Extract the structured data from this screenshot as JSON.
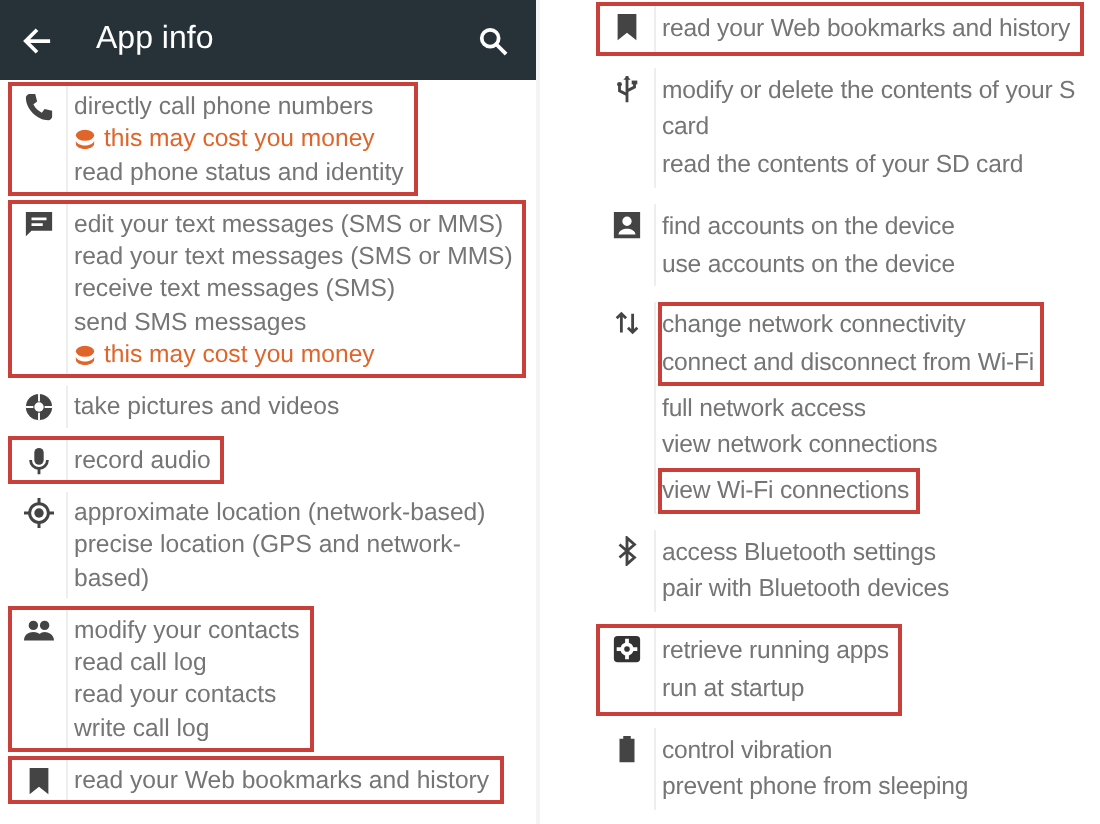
{
  "left_screen": {
    "app_bar": {
      "title": "App info"
    },
    "groups": [
      {
        "highlighted": true,
        "blocks": [
          {
            "highlighted": false,
            "lines": [
              {
                "kind": "permission",
                "text": "directly call phone numbers"
              },
              {
                "kind": "cost",
                "text": "this may cost you money"
              },
              {
                "kind": "permission",
                "text": "read phone status and identity"
              }
            ]
          }
        ]
      },
      {
        "highlighted": true,
        "blocks": [
          {
            "highlighted": false,
            "lines": [
              {
                "kind": "permission",
                "text": "edit your text messages (SMS or MMS)"
              },
              {
                "kind": "permission",
                "text": "read your text messages (SMS or MMS)"
              },
              {
                "kind": "permission",
                "text": "receive text messages (SMS)"
              },
              {
                "kind": "permission",
                "text": "send SMS messages"
              },
              {
                "kind": "cost",
                "text": "this may cost you money"
              }
            ]
          }
        ]
      },
      {
        "highlighted": false,
        "blocks": [
          {
            "highlighted": false,
            "lines": [
              {
                "kind": "permission",
                "text": "take pictures and videos"
              }
            ]
          }
        ]
      },
      {
        "highlighted": true,
        "blocks": [
          {
            "highlighted": false,
            "lines": [
              {
                "kind": "permission",
                "text": "record audio"
              }
            ]
          }
        ]
      },
      {
        "highlighted": false,
        "blocks": [
          {
            "highlighted": false,
            "lines": [
              {
                "kind": "permission",
                "text": "approximate location (network-based)"
              },
              {
                "kind": "permission",
                "text": "precise location (GPS and network-"
              },
              {
                "kind": "permission",
                "text": "based)"
              }
            ]
          }
        ]
      },
      {
        "highlighted": true,
        "blocks": [
          {
            "highlighted": false,
            "lines": [
              {
                "kind": "permission",
                "text": "modify your contacts"
              },
              {
                "kind": "permission",
                "text": "read call log"
              },
              {
                "kind": "permission",
                "text": "read your contacts"
              },
              {
                "kind": "permission",
                "text": "write call log"
              }
            ]
          }
        ]
      },
      {
        "highlighted": true,
        "blocks": [
          {
            "highlighted": false,
            "lines": [
              {
                "kind": "permission",
                "text": "read your Web bookmarks and history"
              }
            ]
          }
        ]
      }
    ]
  },
  "right_screen": {
    "groups": [
      {
        "highlighted": true,
        "blocks": [
          {
            "highlighted": false,
            "lines": [
              {
                "kind": "permission",
                "text": "read your Web bookmarks and history"
              }
            ]
          }
        ]
      },
      {
        "highlighted": false,
        "blocks": [
          {
            "highlighted": false,
            "lines": [
              {
                "kind": "permission",
                "text": "modify or delete the contents of your S"
              },
              {
                "kind": "permission",
                "text": "card"
              },
              {
                "kind": "permission",
                "text": "read the contents of your SD card"
              }
            ]
          }
        ]
      },
      {
        "highlighted": false,
        "blocks": [
          {
            "highlighted": false,
            "lines": [
              {
                "kind": "permission",
                "text": "find accounts on the device"
              },
              {
                "kind": "permission",
                "text": "use accounts on the device"
              }
            ]
          }
        ]
      },
      {
        "highlighted": false,
        "blocks": [
          {
            "highlighted": true,
            "lines": [
              {
                "kind": "permission",
                "text": "change network connectivity"
              },
              {
                "kind": "permission",
                "text": "connect and disconnect from Wi-Fi"
              }
            ]
          },
          {
            "highlighted": false,
            "lines": [
              {
                "kind": "permission",
                "text": "full network access"
              },
              {
                "kind": "permission",
                "text": "view network connections"
              }
            ]
          },
          {
            "highlighted": true,
            "lines": [
              {
                "kind": "permission",
                "text": "view Wi-Fi connections"
              }
            ]
          }
        ]
      },
      {
        "highlighted": false,
        "blocks": [
          {
            "highlighted": false,
            "lines": [
              {
                "kind": "permission",
                "text": "access Bluetooth settings"
              },
              {
                "kind": "permission",
                "text": "pair with Bluetooth devices"
              }
            ]
          }
        ]
      },
      {
        "highlighted": true,
        "blocks": [
          {
            "highlighted": false,
            "lines": [
              {
                "kind": "permission",
                "text": "retrieve running apps"
              },
              {
                "kind": "permission",
                "text": "run at startup"
              }
            ]
          }
        ]
      },
      {
        "highlighted": false,
        "blocks": [
          {
            "highlighted": false,
            "lines": [
              {
                "kind": "permission",
                "text": "control vibration"
              },
              {
                "kind": "permission",
                "text": "prevent phone from sleeping"
              }
            ]
          }
        ]
      }
    ]
  }
}
